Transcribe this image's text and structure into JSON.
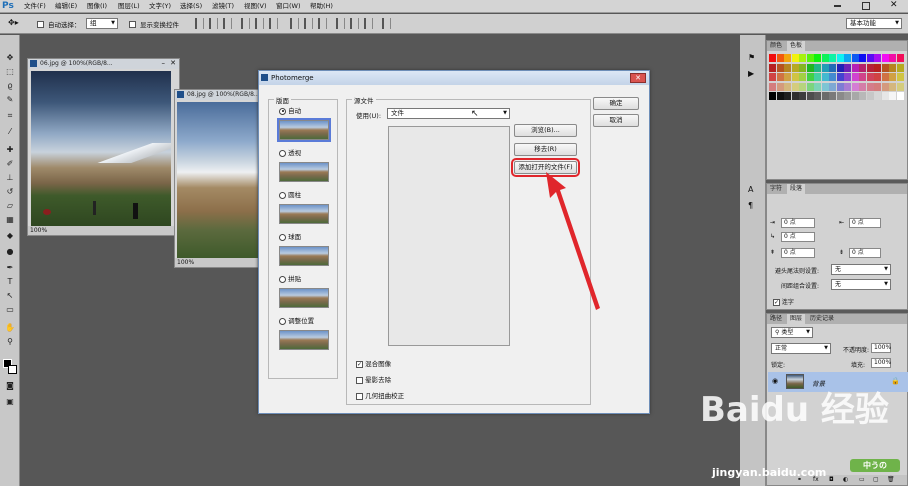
{
  "menubar": {
    "logo": "Ps",
    "items": [
      "文件(F)",
      "编辑(E)",
      "图像(I)",
      "图层(L)",
      "文字(Y)",
      "选择(S)",
      "滤镜(T)",
      "视图(V)",
      "窗口(W)",
      "帮助(H)"
    ]
  },
  "options": {
    "auto_select_label": "自动选择：",
    "auto_select_value": "组",
    "show_transform_label": "显示变换控件",
    "workspace": "基本功能"
  },
  "doc1": {
    "title": "06.jpg @ 100%(RGB/8...",
    "zoom": "100%"
  },
  "doc2": {
    "title": "08.jpg @ 100%(RGB/8...",
    "zoom": "100%"
  },
  "dialog": {
    "title": "Photomerge",
    "layout_group": "版面",
    "layouts": [
      "自动",
      "透视",
      "圆柱",
      "球面",
      "拼贴",
      "调整位置"
    ],
    "selected_layout": "自动",
    "source_group": "源文件",
    "use_label": "使用(U):",
    "use_value": "文件",
    "browse": "浏览(B)...",
    "remove": "移去(R)",
    "add_open": "添加打开的文件(F)",
    "ok": "确定",
    "cancel": "取消",
    "options": [
      {
        "label": "混合图像",
        "checked": true
      },
      {
        "label": "晕影去除",
        "checked": false
      },
      {
        "label": "几何扭曲校正",
        "checked": false
      }
    ]
  },
  "panels": {
    "color_tabs": [
      "颜色",
      "色板"
    ],
    "char_tabs": [
      "字符",
      "段落"
    ],
    "para_fields": [
      "0 点",
      "0 点",
      "0 点",
      "0 点",
      "0 点"
    ],
    "hyphen_label": "避头尾法则设置:",
    "hyphen_value": "无",
    "spacing_label": "间距组合设置:",
    "spacing_value": "无",
    "hyphenate": "连字",
    "layer_tabs": [
      "路径",
      "图层",
      "历史记录"
    ],
    "kind": "类型",
    "blend": "正常",
    "opacity_label": "不透明度:",
    "opacity": "100%",
    "lock_label": "锁定:",
    "fill_label": "填充:",
    "fill": "100%",
    "layer_name": "背景"
  },
  "watermark": {
    "brand": "Baidu 经验",
    "url": "jingyan.baidu.com",
    "badge": "中うの"
  },
  "colors": {
    "annotation": "#e0262b",
    "accent": "#5a7bd8"
  }
}
